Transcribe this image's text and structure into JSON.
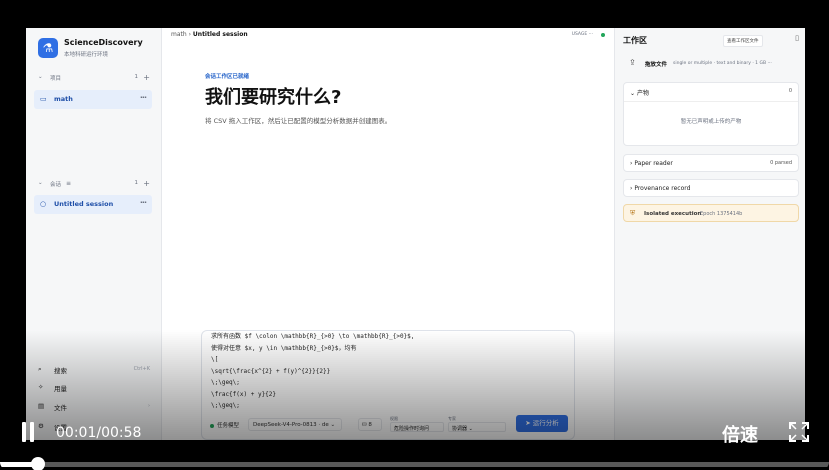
{
  "sidebar": {
    "brand": "ScienceDiscovery",
    "brand_sub": "本地科研运行环境",
    "projects_label": "项目",
    "projects_count": "1",
    "project_item": "math",
    "sessions_label": "会话",
    "sessions_count": "1",
    "session_item": "Untitled session",
    "search_label": "搜索",
    "search_kbd": "Ctrl+K",
    "usage_label": "用量",
    "files_label": "文件",
    "settings_label": "设置"
  },
  "main": {
    "crumb_project": "math",
    "crumb_session": "Untitled session",
    "usage_badge": "USAGE",
    "ws_ready": "会话工作区已就绪",
    "title": "我们要研究什么?",
    "subtitle": "将 CSV 拖入工作区，然后让已配置的模型分析数据并创建图表。",
    "code_lines": [
      "求所有函数 $f \\colon \\mathbb{R}_{>0} \\to \\mathbb{R}_{>0}$,",
      "使得对任意 $x, y \\in \\mathbb{R}_{>0}$，均有",
      "\\[",
      "\\sqrt{\\frac{x^{2} + f(y)^{2}}{2}}",
      "\\;\\geq\\;",
      "\\frac{f(x) + y}{2}",
      "\\;\\geq\\;"
    ],
    "model_label": "任务模型",
    "model_value": "DeepSeek-V4-Pro-0813 · de",
    "db_value": "8",
    "perm_label": "权限",
    "perm_value": "危险操作时询问",
    "mode_label": "专家",
    "mode_value": "协调器",
    "run_label": "运行分析"
  },
  "right": {
    "title": "工作区",
    "view_button": "查看工作区文件",
    "upload_label": "拖放文件",
    "upload_hint": "single or multiple · text and binary · 1 GB ···",
    "outputs_label": "产物",
    "outputs_count": "0",
    "outputs_empty": "暂无已声明或上传的产物",
    "paper_reader_label": "Paper reader",
    "paper_reader_count": "0 parsed",
    "provenance_label": "Provenance record",
    "isolated_label": "Isolated execution",
    "epoch_label": "Epoch 1375414b"
  },
  "player": {
    "time": "00:01/00:58",
    "speed": "倍速",
    "progress": 0.017
  }
}
